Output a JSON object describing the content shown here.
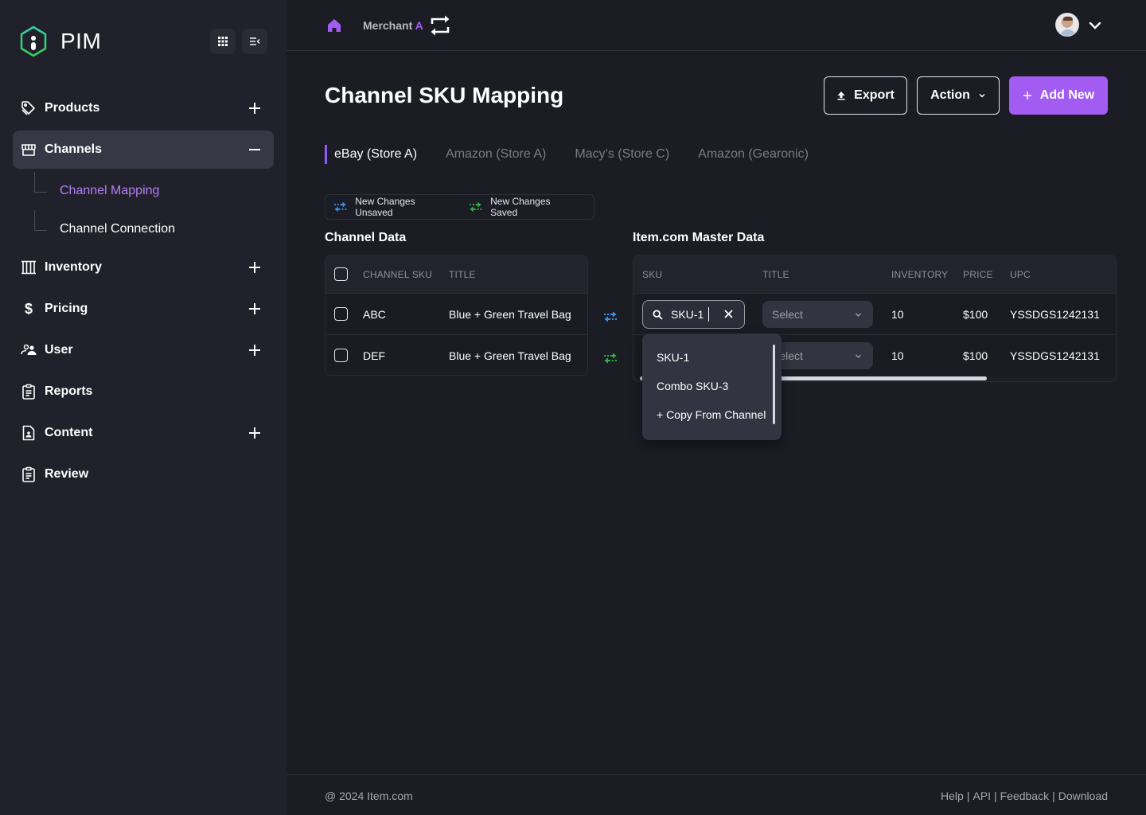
{
  "app": {
    "name": "PIM",
    "logo_icon": "hexagon-info-logo"
  },
  "sidebar": {
    "top_buttons": [
      {
        "name": "apps-grid",
        "icon": "grid-icon"
      },
      {
        "name": "collapse-sidebar",
        "icon": "collapse-menu-icon"
      }
    ],
    "items": [
      {
        "label": "Products",
        "icon": "tag-icon",
        "toggle": "plus"
      },
      {
        "label": "Channels",
        "icon": "store-icon",
        "toggle": "minus",
        "active": true,
        "children": [
          {
            "label": "Channel Mapping",
            "active": true
          },
          {
            "label": "Channel Connection",
            "active": false
          }
        ]
      },
      {
        "label": "Inventory",
        "icon": "warehouse-icon",
        "toggle": "plus"
      },
      {
        "label": "Pricing",
        "icon": "dollar-icon",
        "toggle": "plus"
      },
      {
        "label": "User",
        "icon": "users-icon",
        "toggle": "plus"
      },
      {
        "label": "Reports",
        "icon": "clipboard-icon",
        "toggle": null
      },
      {
        "label": "Content",
        "icon": "document-user-icon",
        "toggle": "plus"
      },
      {
        "label": "Review",
        "icon": "clipboard-icon",
        "toggle": null
      }
    ]
  },
  "topbar": {
    "merchant_prefix": "Merchant ",
    "merchant_accent": "A",
    "icons": [
      "home-icon",
      "switch-icon",
      "avatar",
      "chevron-down-icon"
    ]
  },
  "page": {
    "title": "Channel SKU Mapping",
    "buttons": {
      "export": "Export",
      "action": "Action",
      "add_new": "Add New"
    },
    "tabs": [
      {
        "label": "eBay (Store A)",
        "active": true
      },
      {
        "label": "Amazon (Store A)",
        "active": false
      },
      {
        "label": "Macy’s (Store C)",
        "active": false
      },
      {
        "label": "Amazon (Gearonic)",
        "active": false
      }
    ],
    "legend": {
      "unsaved": "New Changes Unsaved",
      "saved": "New Changes Saved"
    }
  },
  "channel_table": {
    "title": "Channel Data",
    "columns": [
      "CHANNEL SKU",
      "TITLE"
    ],
    "rows": [
      {
        "sku": "ABC",
        "title": "Blue + Green Travel Bag",
        "status": "unsaved"
      },
      {
        "sku": "DEF",
        "title": "Blue + Green Travel Bag",
        "status": "saved"
      }
    ]
  },
  "master_table": {
    "title": "Item.com Master Data",
    "columns": [
      "SKU",
      "TITLE",
      "INVENTORY",
      "PRICE",
      "UPC"
    ],
    "rows": [
      {
        "sku_input": "SKU-1",
        "title_select": "Select",
        "inventory": "10",
        "price": "$100",
        "upc": "YSSDGS1242131"
      },
      {
        "sku_input": "",
        "title_select": "Select",
        "inventory": "10",
        "price": "$100",
        "upc": "YSSDGS1242131"
      }
    ],
    "sku_dropdown": [
      "SKU-1",
      "Combo SKU-3",
      "+ Copy From Channel"
    ]
  },
  "colors": {
    "accent": "#a35cf2",
    "unsaved": "#3b8fe6",
    "saved": "#2fb344",
    "sidebar_bg": "#20212a",
    "main_bg": "#1b1c24"
  },
  "footer": {
    "copyright": "@ 2024 Item.com",
    "links": [
      "Help",
      "API",
      "Feedback",
      "Download"
    ]
  }
}
